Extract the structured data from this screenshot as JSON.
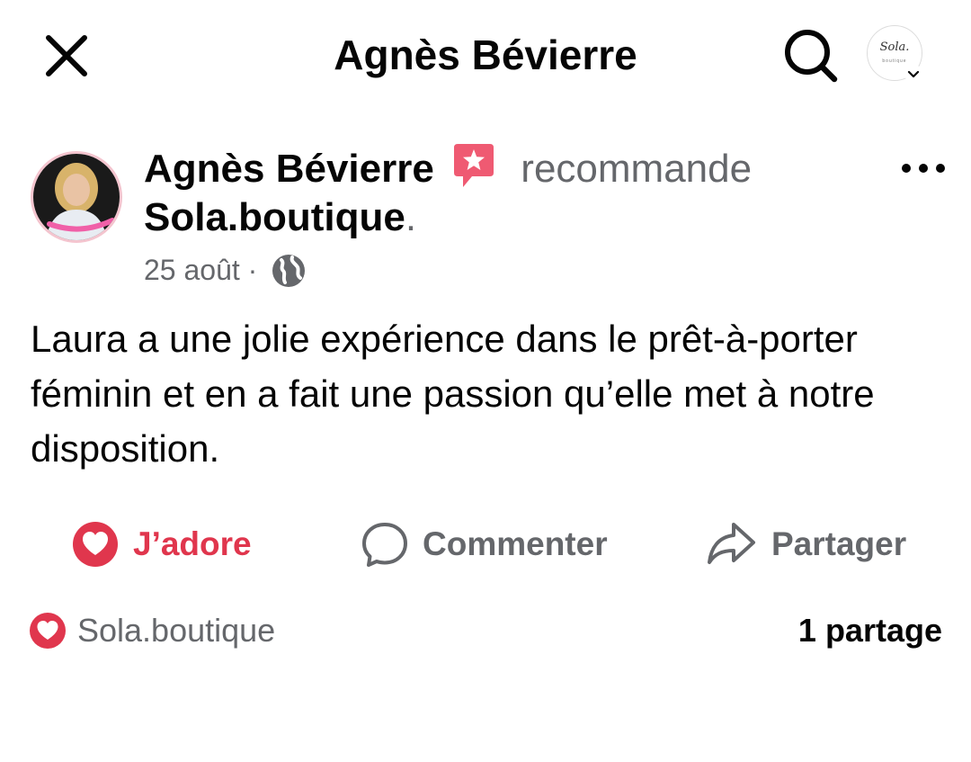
{
  "header": {
    "title": "Agnès Bévierre",
    "close_icon": "close-icon",
    "search_icon": "search-icon",
    "profile_logo_text": "Sola.",
    "profile_logo_sub": "boutique"
  },
  "post": {
    "author": "Agnès Bévierre",
    "badge_icon": "recommend-star-icon",
    "verb": "recommande",
    "page": "Sola.boutique",
    "period": ".",
    "date": "25 août",
    "separator": " · ",
    "audience_icon": "globe-icon",
    "text": "Laura a une jolie expérience dans le prêt-à-porter féminin et en a fait une passion qu’elle met à notre disposition."
  },
  "actions": {
    "like_label": "J’adore",
    "comment_label": "Commenter",
    "share_label": "Partager"
  },
  "reactions": {
    "reactor": "Sola.boutique",
    "shares": "1 partage"
  },
  "colors": {
    "love": "#e0364d",
    "secondary_text": "#65676b",
    "primary_text": "#050505",
    "badge": "#ef5a72"
  }
}
